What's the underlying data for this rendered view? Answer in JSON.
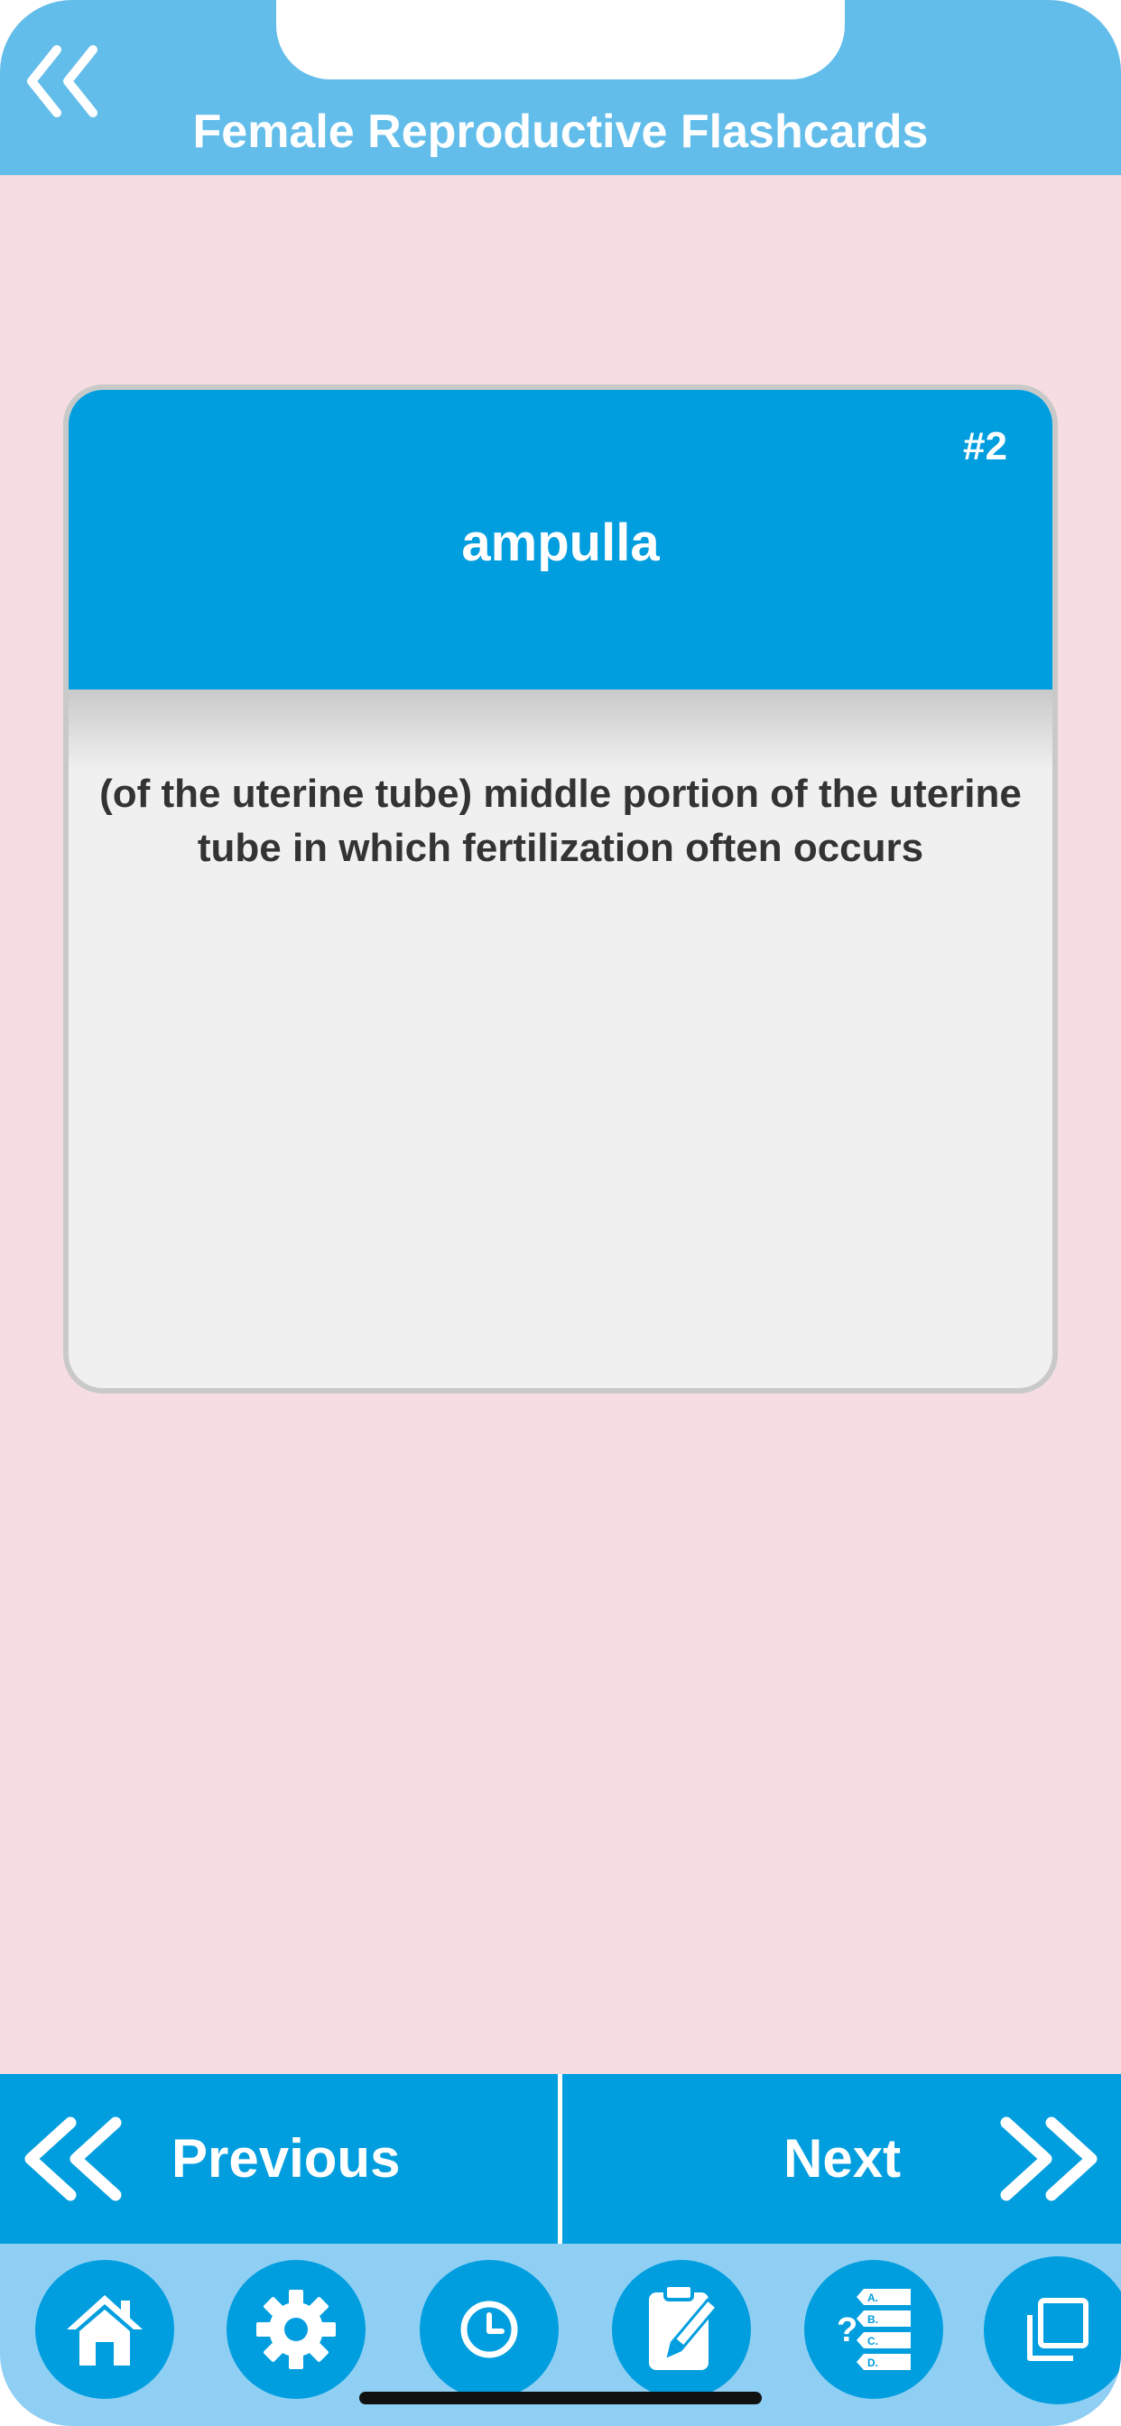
{
  "header": {
    "title": "Female Reproductive Flashcards",
    "back_icon": "double-chevron-left-icon"
  },
  "card": {
    "number": "#2",
    "term": "ampulla",
    "definition": "(of the uterine tube) middle portion of the uterine tube in which fertilization often occurs"
  },
  "nav": {
    "previous_label": "Previous",
    "next_label": "Next"
  },
  "tabbar": {
    "items": [
      "home-icon",
      "gear-icon",
      "clock-icon",
      "clipboard-edit-icon",
      "quiz-list-icon",
      "copy-icon"
    ]
  },
  "colors": {
    "header_bg": "#63bdea",
    "accent": "#009edf",
    "page_bg": "#f5dde1",
    "card_bg": "#f0f0f0",
    "tabbar_bg": "#8fcff4"
  }
}
